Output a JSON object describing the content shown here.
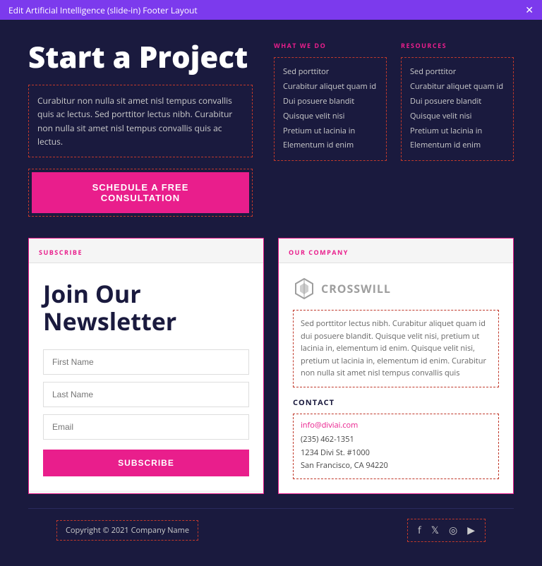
{
  "titlebar": {
    "label": "Edit Artificial Intelligence (slide-in) Footer Layout",
    "close": "✕"
  },
  "hero": {
    "title": "Start a Project",
    "description": "Curabitur non nulla sit amet nisl tempus convallis quis ac lectus. Sed porttitor lectus nibh. Curabitur non nulla sit amet nisl tempus convallis quis ac lectus.",
    "cta_label": "SCHEDULE A FREE CONSULTATION"
  },
  "what_we_do": {
    "title": "WHAT WE DO",
    "items": [
      "Sed porttitor",
      "Curabitur aliquet quam id",
      "Dui posuere blandit",
      "Quisque velit nisi",
      "Pretium ut lacinia in",
      "Elementum id enim"
    ]
  },
  "resources": {
    "title": "RESOURCES",
    "items": [
      "Sed porttitor",
      "Curabitur aliquet quam id",
      "Dui posuere blandit",
      "Quisque velit nisi",
      "Pretium ut lacinia in",
      "Elementum id enim"
    ]
  },
  "subscribe": {
    "header_label": "SUBSCRIBE",
    "title_line1": "Join Our",
    "title_line2": "Newsletter",
    "first_name_placeholder": "First Name",
    "last_name_placeholder": "Last Name",
    "email_placeholder": "Email",
    "button_label": "SUBSCRIBE"
  },
  "company": {
    "header_label": "OUR COMPANY",
    "logo_text": "CROSSWILL",
    "description": "Sed porttitor lectus nibh. Curabitur aliquet quam id dui posuere blandit. Quisque velit nisi, pretium ut lacinia in, elementum id enim. Quisque velit nisi, pretium ut lacinia in, elementum id enim. Curabitur non nulla sit amet nisl tempus convallis quis",
    "contact_title": "CONTACT",
    "email": "info@diviai.com",
    "phone": "(235) 462-1351",
    "address1": "1234 Divi St. #1000",
    "address2": "San Francisco, CA 94220"
  },
  "footer": {
    "copyright": "Copyright © 2021 Company Name",
    "social": [
      "f",
      "t",
      "in",
      "▶"
    ]
  }
}
